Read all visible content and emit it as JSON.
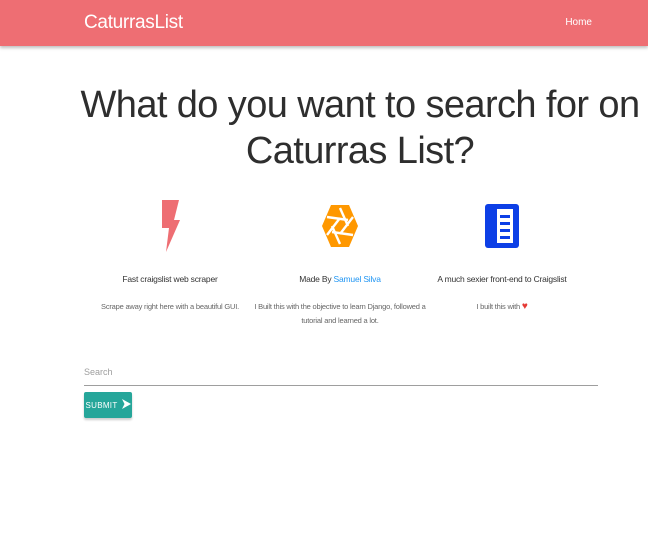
{
  "navbar": {
    "brand": "CaturrasList",
    "home_label": "Home",
    "color": "#ee6e73"
  },
  "headline": "What do you want to search for on Caturras List?",
  "features": [
    {
      "icon": "flash-icon",
      "icon_color": "#ee6e73",
      "title": "Fast craigslist web scraper",
      "description": "Scrape away right here with a beautiful GUI."
    },
    {
      "icon": "camera-aperture-icon",
      "icon_color": "#ff9800",
      "title_prefix": "Made By ",
      "title_link": "Samuel Silva",
      "description": "I Built this with the objective to learn Django, followed a tutorial and learned a lot."
    },
    {
      "icon": "document-icon",
      "icon_color": "#0d3fe6",
      "title": "A much sexier front-end to Craigslist",
      "description": "I built this with",
      "heart": "♥"
    }
  ],
  "search": {
    "placeholder": "Search",
    "value": ""
  },
  "submit": {
    "label": "SUBMIT",
    "arrow": "➤",
    "color": "#26a69a"
  }
}
